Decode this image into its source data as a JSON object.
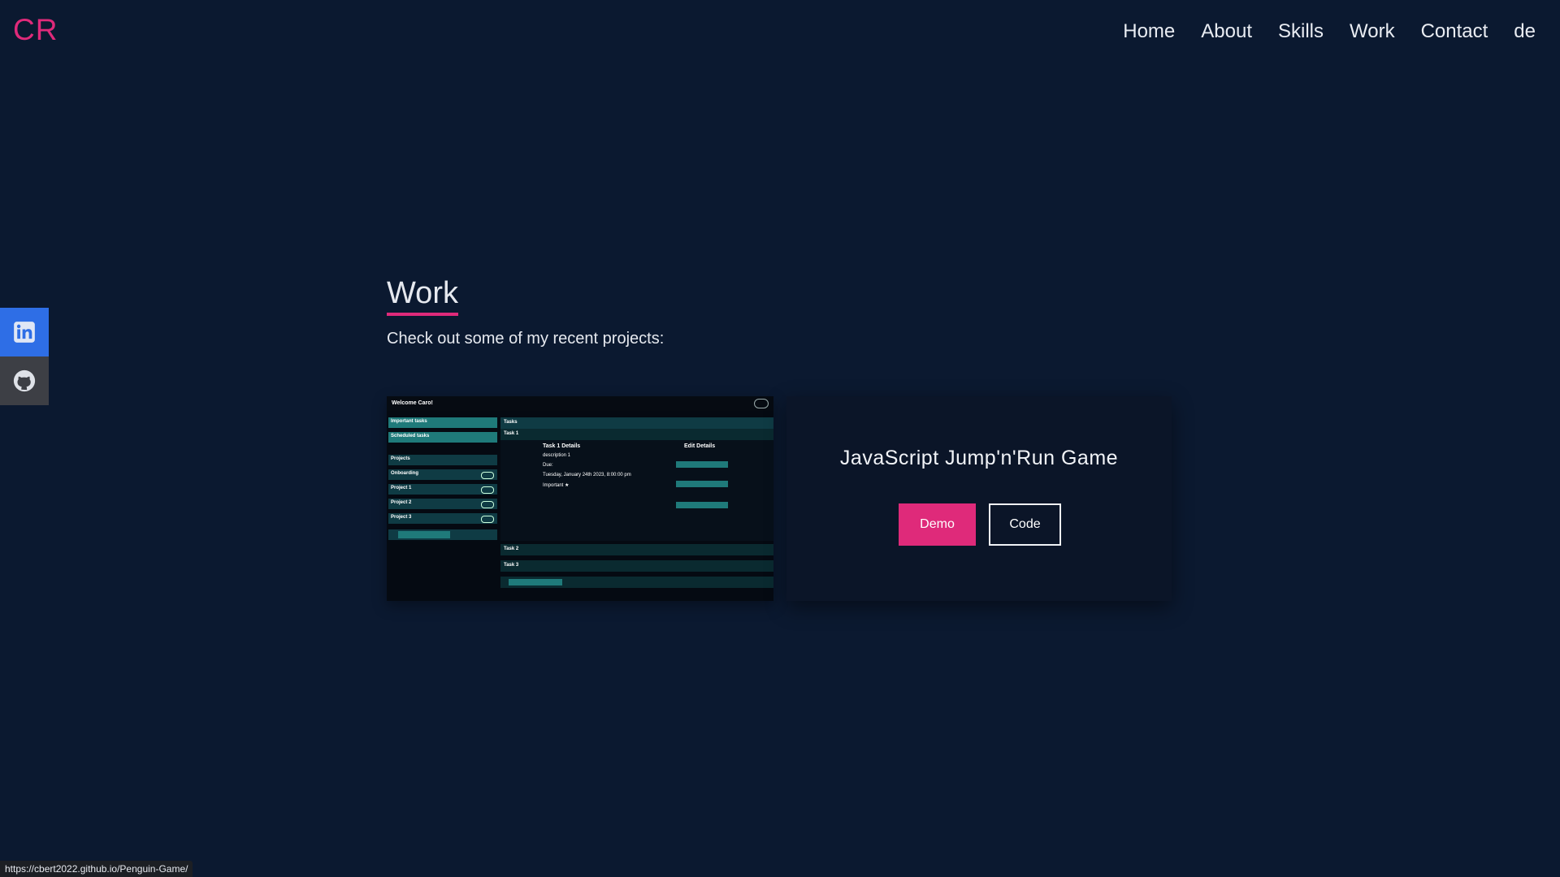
{
  "header": {
    "logo": "CR",
    "nav": [
      "Home",
      "About",
      "Skills",
      "Work",
      "Contact",
      "de"
    ]
  },
  "social": [
    "linkedin-icon",
    "github-icon"
  ],
  "work": {
    "title": "Work",
    "intro": "Check out some of my recent projects:",
    "project": {
      "title": "JavaScript Jump'n'Run Game",
      "demo_label": "Demo",
      "code_label": "Code"
    }
  },
  "preview": {
    "welcome": "Welcome Caro!",
    "important": "Important tasks",
    "scheduled": "Scheduled tasks",
    "projects": "Projects",
    "project_items": [
      "Onboarding",
      "Project 1",
      "Project 2",
      "Project 3"
    ],
    "tasks": "Tasks",
    "task1": "Task 1",
    "task2": "Task 2",
    "task3": "Task 3",
    "details": "Task 1 Details",
    "edit": "Edit Details",
    "desc": "description 1",
    "due": "Due:",
    "date": "Tuesday, January 24th 2023, 8:00:00 pm",
    "important_label": "Important ★"
  },
  "status_url": "https://cbert2022.github.io/Penguin-Game/",
  "colors": {
    "background": "#0b1930",
    "accent": "#df2a7a",
    "linkedin": "#2e6ee6",
    "github": "#3d3f45"
  }
}
